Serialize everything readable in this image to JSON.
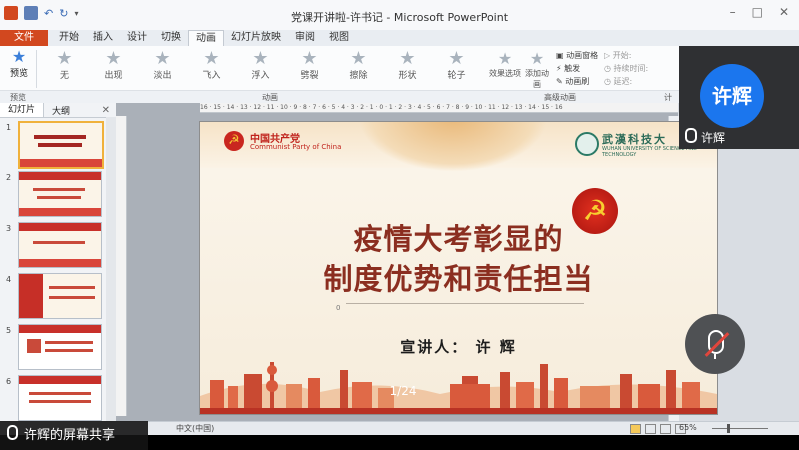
{
  "window": {
    "title": "党课开讲啦-许书记 - Microsoft PowerPoint",
    "controls": [
      "–",
      "□",
      "✕"
    ]
  },
  "ribbon": {
    "tabs": [
      "文件",
      "开始",
      "插入",
      "设计",
      "切换",
      "动画",
      "幻灯片放映",
      "审阅",
      "视图"
    ],
    "active_tab": "动画",
    "preview_label": "预览",
    "effects": [
      "无",
      "出现",
      "淡出",
      "飞入",
      "浮入",
      "劈裂",
      "擦除",
      "形状",
      "轮子"
    ],
    "effect_options_label": "效果选项",
    "add_animation_label": "添加动画",
    "advanced": [
      "动画窗格",
      "触发",
      "动画刷"
    ],
    "timing": [
      "开始:",
      "持续时间:",
      "延迟:"
    ],
    "group_labels": [
      "预览",
      "动画",
      "高级动画",
      "计"
    ]
  },
  "left_panel": {
    "tabs": [
      "幻灯片",
      "大纲"
    ],
    "close": "✕",
    "slide_numbers": [
      "1",
      "2",
      "3",
      "4",
      "5",
      "6"
    ]
  },
  "ruler": {
    "marks": "16 · 15 · 14 · 13 · 12 · 11 · 10 · 9 · 8 · 7 · 6 · 5 · 4 · 3 · 2 · 1 · 0 · 1 · 2 · 3 · 4 · 5 · 6 · 7 · 8 · 9 · 10 · 11 · 12 · 13 · 14 · 15 · 16"
  },
  "slide": {
    "cpc_cn": "中国共产党",
    "cpc_en": "Communist Party of China",
    "wust_cn": "武漢科技大",
    "wust_en": "WUHAN UNIVERSITY OF SCIENCE AND TECHNOLOGY",
    "title_line1": "疫情大考彰显的",
    "title_line2": "制度优势和责任担当",
    "ruler_zero": "0",
    "speaker": "宣讲人：  许  辉",
    "emblem_glyph": "☭",
    "page_indicator": "1/24"
  },
  "video_tile": {
    "avatar_text": "许辉",
    "name": "许辉",
    "avatar_color": "#1b76ee"
  },
  "statusbar": {
    "language": "中文(中国)",
    "zoom": "65%"
  },
  "share_banner": {
    "text": "许辉的屏幕共享"
  }
}
